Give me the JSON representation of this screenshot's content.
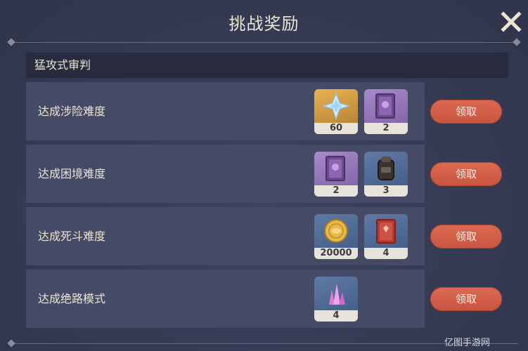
{
  "window": {
    "title": "挑战奖励",
    "close_icon": "close-x-icon"
  },
  "section": {
    "title": "猛攻式审判"
  },
  "rows": [
    {
      "label": "达成涉险难度",
      "rewards": [
        {
          "icon": "primogem-icon",
          "count": "60",
          "rarity": "gold"
        },
        {
          "icon": "purple-book-icon",
          "count": "2",
          "rarity": "purple"
        }
      ],
      "button": "领取"
    },
    {
      "label": "达成困境难度",
      "rewards": [
        {
          "icon": "purple-book-icon",
          "count": "2",
          "rarity": "purple"
        },
        {
          "icon": "backpack-icon",
          "count": "3",
          "rarity": "blue"
        }
      ],
      "button": "领取"
    },
    {
      "label": "达成死斗难度",
      "rewards": [
        {
          "icon": "mora-coin-icon",
          "count": "20000",
          "rarity": "blue"
        },
        {
          "icon": "red-book-icon",
          "count": "4",
          "rarity": "blue"
        }
      ],
      "button": "领取"
    },
    {
      "label": "达成绝路模式",
      "rewards": [
        {
          "icon": "crystal-icon",
          "count": "4",
          "rarity": "blue"
        }
      ],
      "button": "领取"
    }
  ],
  "watermark": "亿图手游网"
}
